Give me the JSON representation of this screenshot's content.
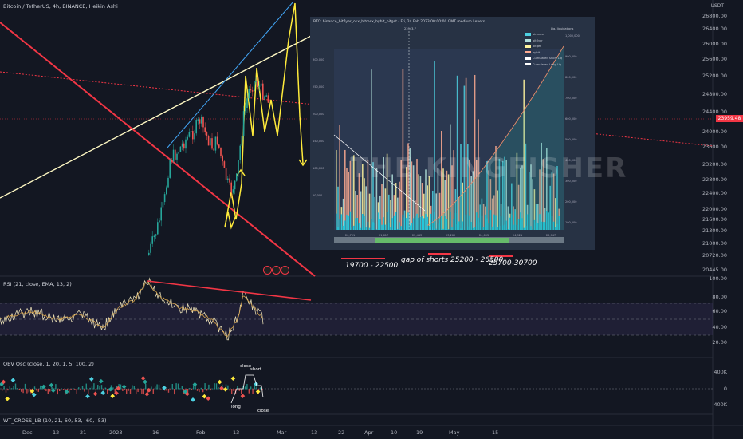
{
  "header": {
    "main_title": "Bitcoin / TetherUS, 4h, BINANCE, Heikin Ashi",
    "currency": "USDT",
    "current_price": "23959.48",
    "rsi_title": "RSI (21, close, EMA, 13, 2)",
    "obv_title": "OBV Osc (close, 1, 20, 1, 5, 100, 2)",
    "wt_title": "WT_CROSS_LB (10, 21, 60, 53, -60, -53)"
  },
  "price_axis": [
    "26800.00",
    "26400.00",
    "26000.00",
    "25600.00",
    "25200.00",
    "24800.00",
    "24400.00",
    "24000.00",
    "23600.00",
    "23200.00",
    "22800.00",
    "22400.00",
    "22000.00",
    "21600.00",
    "21300.00",
    "21000.00",
    "20720.00",
    "20445.00"
  ],
  "rsi_axis": [
    "100.00",
    "80.00",
    "60.00",
    "40.00",
    "20.00"
  ],
  "obv_axis": [
    "400K",
    "0",
    "-400K"
  ],
  "time_axis": [
    "Dec",
    "12",
    "21",
    "2023",
    "16",
    "Feb",
    "13",
    "Mar",
    "13",
    "22",
    "Apr",
    "10",
    "19",
    "May",
    "15"
  ],
  "annotations": {
    "range_low": "19700 - 22500",
    "gap_shorts": "gap of shorts 25200 - 26500",
    "range_high": "29700-30700"
  },
  "obv_notes": {
    "close_top": "close",
    "short": "short",
    "long": "long",
    "close_bottom": "close"
  },
  "inset": {
    "title": "BTC: binance_bitflyer_okx_bitmex_bybit_bitget - Fri, 24 Feb 2023 00:00:00 GMT  medium Levers",
    "legend_header": "Liq. liquidations",
    "legend": [
      {
        "label": "binance",
        "color": "#4dd0e1"
      },
      {
        "label": "bitflyer",
        "color": "#b2dfdb"
      },
      {
        "label": "bitget",
        "color": "#fff59d"
      },
      {
        "label": "bybit",
        "color": "#ffab91"
      },
      {
        "label": "Cumulated Short Liq",
        "color": "#ffffff"
      },
      {
        "label": "Cumulated Long Liq",
        "color": "#ffffff"
      }
    ],
    "marker_label": "23943.7",
    "watermark": "THE KINGFISHER",
    "y_ticks_left": [
      "300,000",
      "250,000",
      "200,000",
      "150,000",
      "100,000",
      "50,000"
    ],
    "y_ticks_right": [
      "1,000,000",
      "900,000",
      "800,000",
      "700,000",
      "600,000",
      "500,000",
      "400,000",
      "300,000",
      "200,000",
      "100,000"
    ],
    "x_ticks": [
      "20,791",
      "21,617",
      "22,443",
      "23,269",
      "24,095",
      "24,921",
      "25,747"
    ]
  },
  "colors": {
    "background": "#131722",
    "red_line": "#f23645",
    "yellow": "#ffeb3b",
    "blue": "#2196f3",
    "candle_up": "#26a69a",
    "candle_down": "#ef5350"
  }
}
